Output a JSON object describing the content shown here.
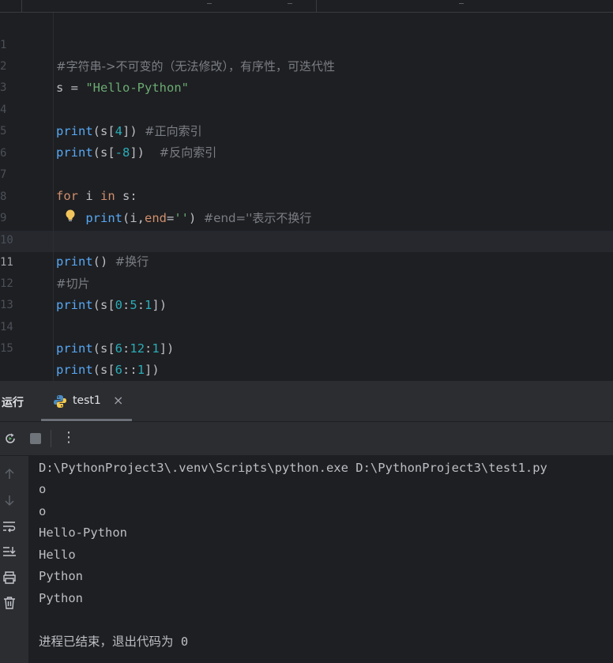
{
  "editor": {
    "line_numbers": [
      "1",
      "2",
      "3",
      "4",
      "5",
      "6",
      "7",
      "8",
      "9",
      "10",
      "11",
      "12",
      "13",
      "14",
      "15"
    ],
    "lines": {
      "l1": {
        "comment": "#字符串->不可变的（无法修改），有序性，可迭代性"
      },
      "l2": {
        "var": "s",
        "eq": " = ",
        "str": "\"Hello-Python\""
      },
      "l4": {
        "fn": "print",
        "a": "(s[",
        "n": "4",
        "b": "]) ",
        "comment": "#正向索引"
      },
      "l5": {
        "fn": "print",
        "a": "(s[",
        "n": "-8",
        "b": "])  ",
        "comment": "#反向索引"
      },
      "l7": {
        "kw1": "for",
        "mid": " i ",
        "kw2": "in",
        "tail": " s:"
      },
      "l8": {
        "indent": "    ",
        "fn": "print",
        "a": "(i,",
        "param": "end",
        "eq": "=",
        "str": "''",
        "b": ") ",
        "comment": "#end=''表示不换行"
      },
      "l10": {
        "fn": "print",
        "a": "() ",
        "comment": "#换行"
      },
      "l11": {
        "comment": "#切片"
      },
      "l12": {
        "fn": "print",
        "a": "(s[",
        "n1": "0",
        "c1": ":",
        "n2": "5",
        "c2": ":",
        "n3": "1",
        "b": "])"
      },
      "l14": {
        "fn": "print",
        "a": "(s[",
        "n1": "6",
        "c1": ":",
        "n2": "12",
        "c2": ":",
        "n3": "1",
        "b": "])"
      },
      "l15": {
        "fn": "print",
        "a": "(s[",
        "n1": "6",
        "c1": "::",
        "n3": "1",
        "b": "])"
      }
    }
  },
  "run_panel": {
    "title": "运行",
    "tab_label": "test1",
    "close_glyph": "×",
    "more_glyph": "⋮",
    "output": [
      "D:\\PythonProject3\\.venv\\Scripts\\python.exe D:\\PythonProject3\\test1.py",
      "o",
      "o",
      "Hello-Python",
      "Hello",
      "Python",
      "Python",
      "",
      "进程已结束，退出代码为 0"
    ]
  },
  "colors": {
    "background": "#1e1f22",
    "keyword": "#cf8e6d",
    "function": "#56a8f5",
    "number": "#2aacb8",
    "string": "#6aab73",
    "comment": "#7a7e85",
    "param": "#c77dbb"
  },
  "icons": [
    "lightbulb-icon",
    "python-icon",
    "close-icon",
    "rerun-icon",
    "stop-icon",
    "more-icon",
    "scroll-up-icon",
    "scroll-down-icon",
    "soft-wrap-icon",
    "scroll-to-end-icon",
    "print-icon",
    "trash-icon"
  ]
}
